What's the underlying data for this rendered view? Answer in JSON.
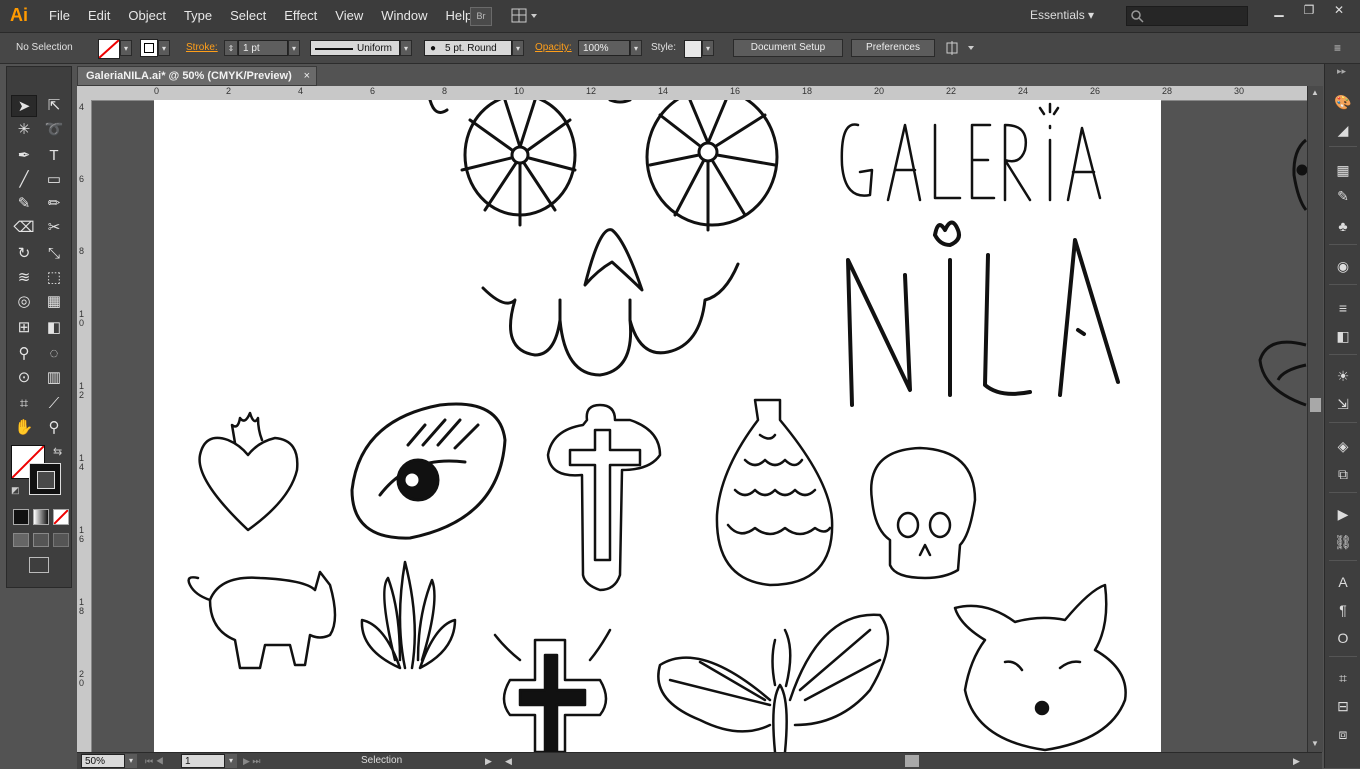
{
  "app": {
    "logo": "Ai"
  },
  "menu": [
    "File",
    "Edit",
    "Object",
    "Type",
    "Select",
    "Effect",
    "View",
    "Window",
    "Help"
  ],
  "topbar": {
    "bridge_label": "Br",
    "workspace": "Essentials",
    "search_placeholder": ""
  },
  "control": {
    "selection_status": "No Selection",
    "stroke_label": "Stroke:",
    "stroke_weight": "1 pt",
    "profile": "Uniform",
    "brush": "5 pt. Round",
    "opacity_label": "Opacity:",
    "opacity_value": "100%",
    "style_label": "Style:",
    "document_setup": "Document Setup",
    "preferences": "Preferences"
  },
  "document": {
    "tab_title": "GaleriaNILA.ai* @ 50% (CMYK/Preview)",
    "close": "×",
    "ruler_top": [
      "0",
      "2",
      "4",
      "6",
      "8",
      "10",
      "12",
      "14",
      "16",
      "18",
      "20",
      "22",
      "24",
      "26",
      "28",
      "30"
    ],
    "ruler_left": [
      "4",
      "6",
      "8",
      "1 0",
      "1 2",
      "1 4",
      "1 6",
      "1 8",
      "2 0"
    ],
    "artwork_text": [
      "GALERIA",
      "NILA"
    ]
  },
  "status": {
    "zoom": "50%",
    "artboard_number": "1",
    "tool": "Selection"
  },
  "colors": {
    "accent_orange": "#ff9f1a",
    "app_bg": "#535353",
    "panel_bg": "#3e3e3e"
  }
}
